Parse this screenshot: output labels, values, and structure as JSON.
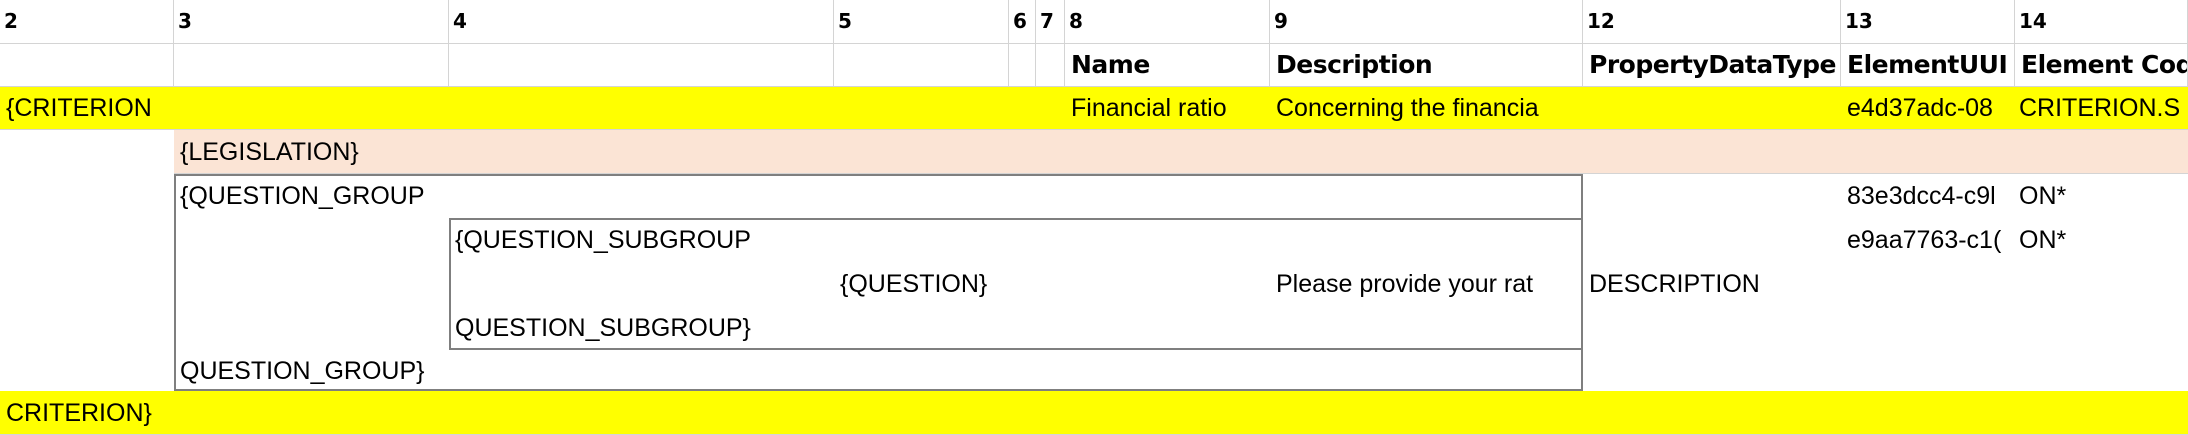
{
  "column_numbers": [
    "2",
    "3",
    "4",
    "5",
    "6",
    "7",
    "8",
    "9",
    "12",
    "13",
    "14"
  ],
  "column_titles": {
    "name": "Name",
    "description": "Description",
    "property_data_type": "PropertyDataType",
    "element_uuid": "ElementUUI",
    "element_code": "Element Cod"
  },
  "rows": {
    "criterion_open": {
      "marker": "{CRITERION",
      "name": "Financial ratio",
      "description": "Concerning the financia",
      "uuid": "e4d37adc-08",
      "code": "CRITERION.S"
    },
    "legislation": {
      "marker": "{LEGISLATION}"
    },
    "question_group_open": {
      "marker": "{QUESTION_GROUP",
      "uuid": "83e3dcc4-c9l",
      "code": "ON*"
    },
    "question_subgroup_open": {
      "marker": "{QUESTION_SUBGROUP",
      "uuid": "e9aa7763-c1(",
      "code": "ON*"
    },
    "question": {
      "marker": "{QUESTION}",
      "description": "Please provide your rat",
      "property_data_type": "DESCRIPTION"
    },
    "question_subgroup_close": {
      "marker": "QUESTION_SUBGROUP}"
    },
    "question_group_close": {
      "marker": "QUESTION_GROUP}"
    },
    "criterion_close": {
      "marker": "CRITERION}"
    }
  },
  "colors": {
    "criterion_highlight": "#ffff00",
    "legislation_highlight": "#fbe4d5",
    "grid": "#d4d4d4",
    "group_border": "#7f7f7f"
  }
}
